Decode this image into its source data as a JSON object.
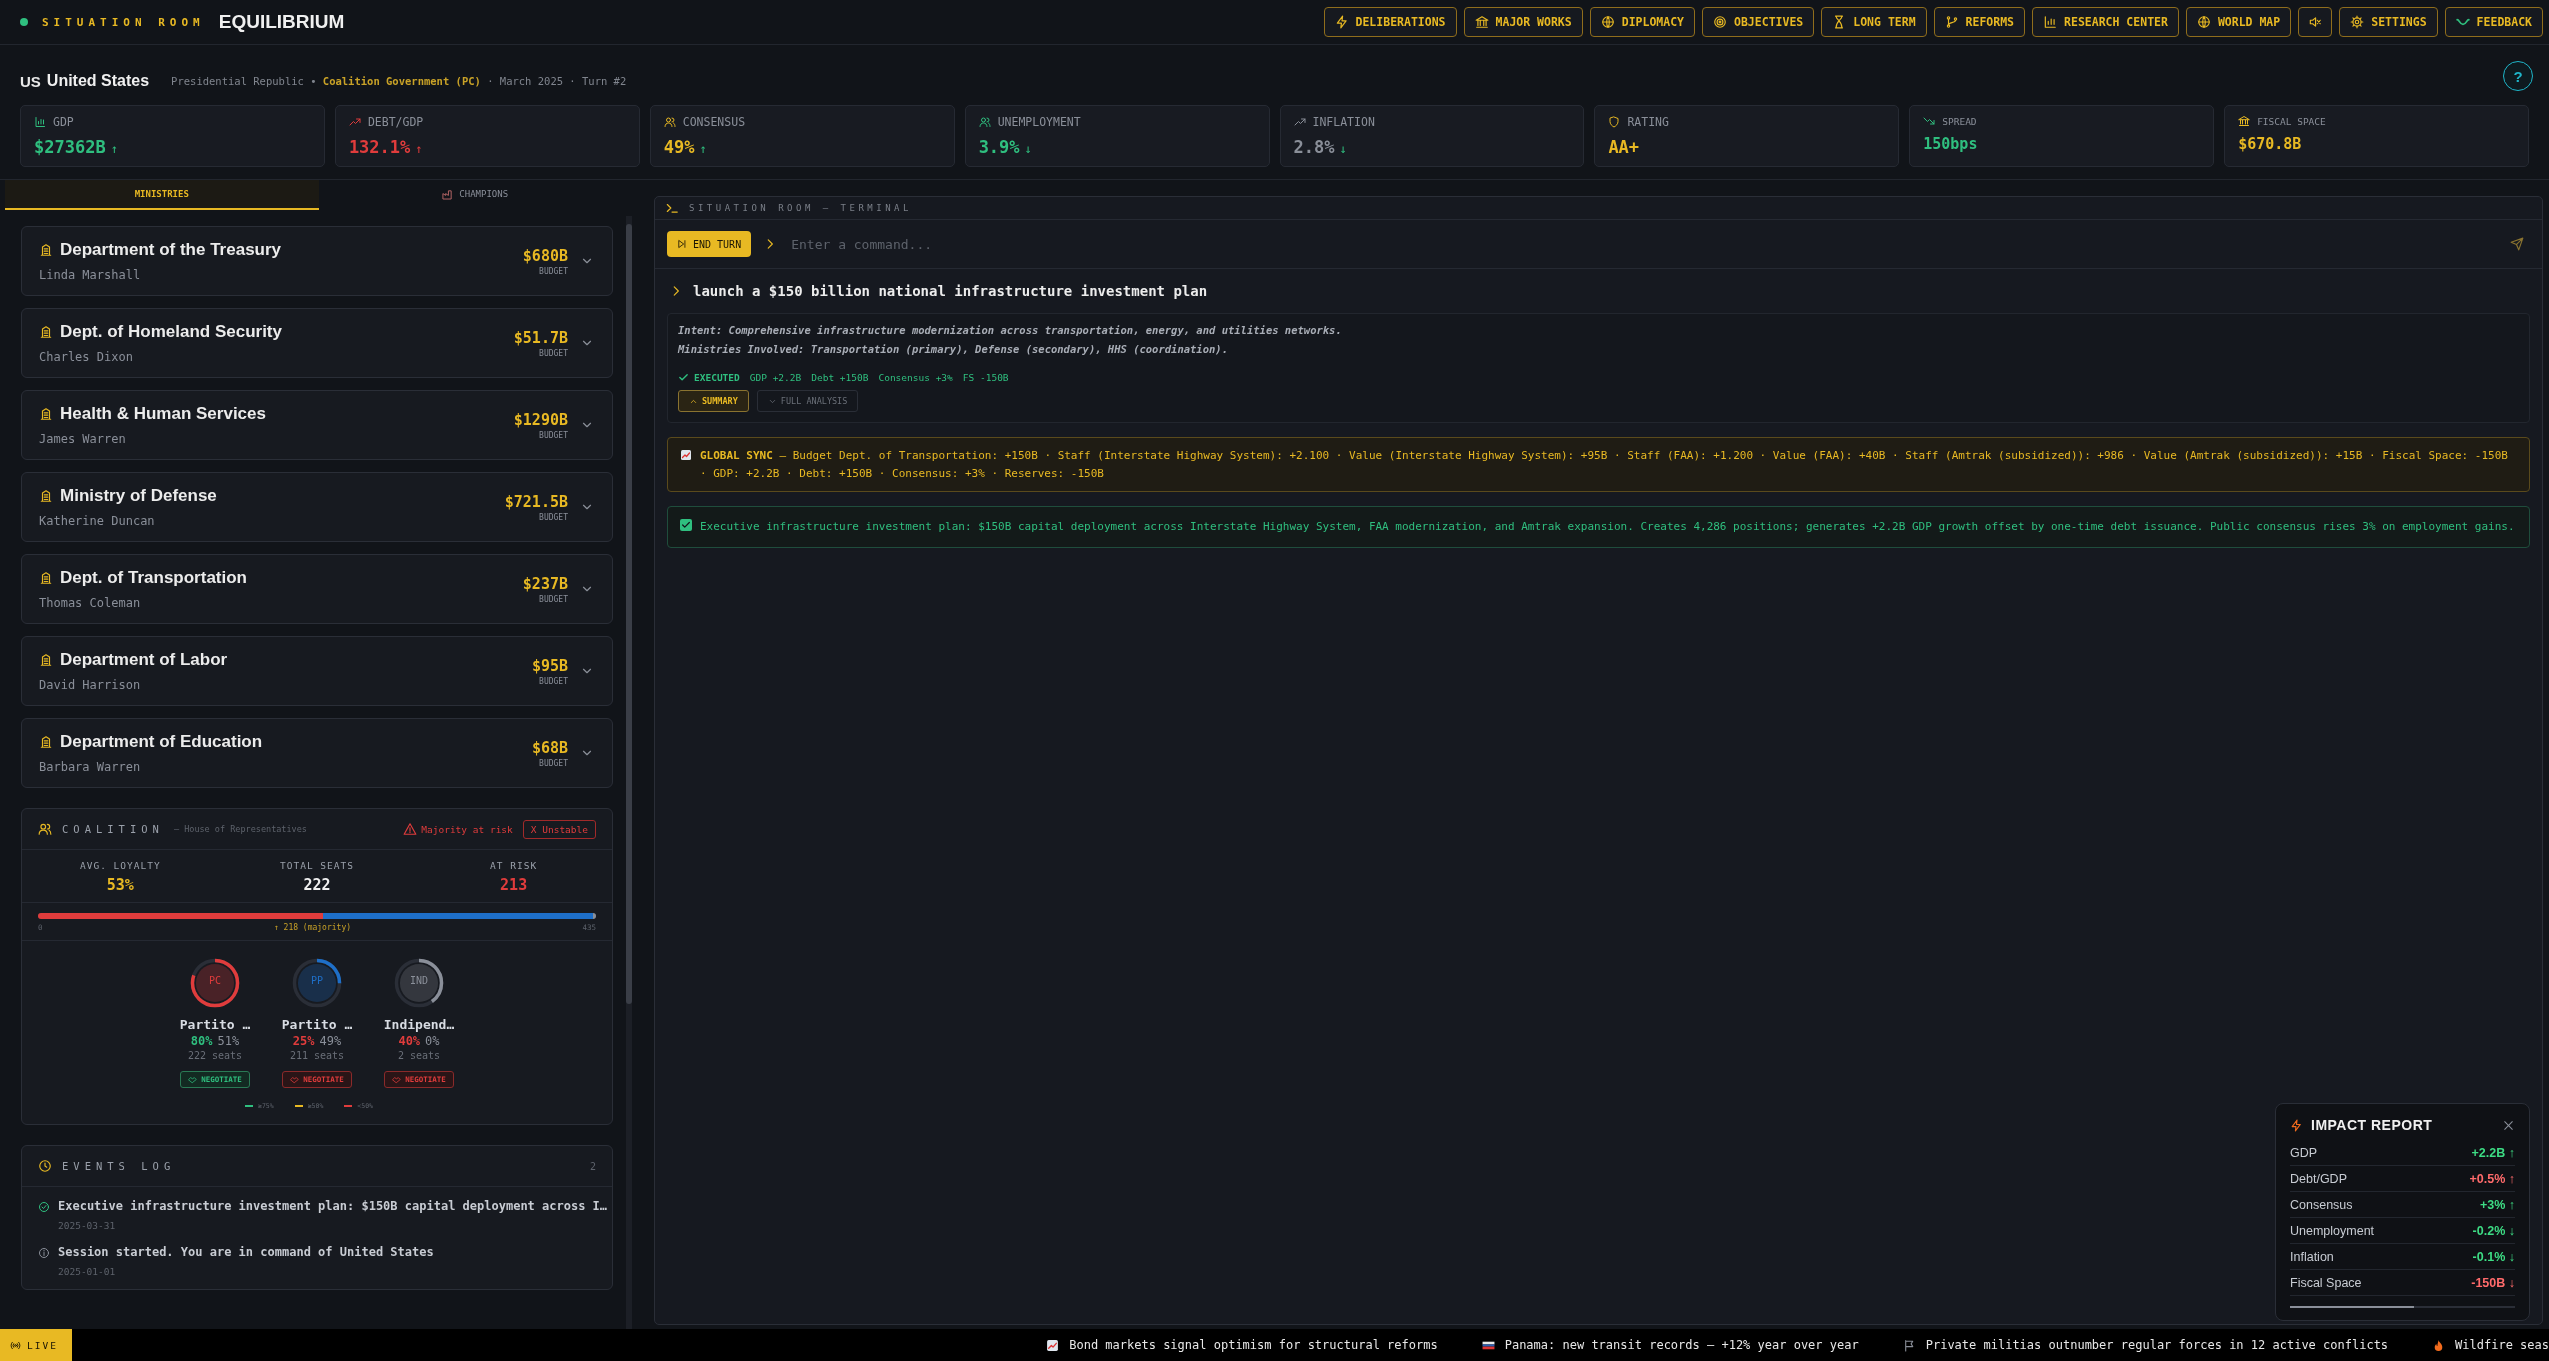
{
  "app": {
    "brand": "SITUATION ROOM",
    "title": "EQUILIBRIUM"
  },
  "nav": [
    {
      "label": "DELIBERATIONS",
      "kind": "bolt"
    },
    {
      "label": "MAJOR WORKS",
      "kind": "bank"
    },
    {
      "label": "DIPLOMACY",
      "kind": "globe"
    },
    {
      "label": "OBJECTIVES",
      "kind": "target"
    },
    {
      "label": "LONG TERM",
      "kind": "hourglass"
    },
    {
      "label": "REFORMS",
      "kind": "branch"
    },
    {
      "label": "RESEARCH CENTER",
      "kind": "bars"
    },
    {
      "label": "WORLD MAP",
      "kind": "globe"
    },
    {
      "kind": "mute"
    },
    {
      "label": "SETTINGS",
      "kind": "gear"
    },
    {
      "label": "FEEDBACK",
      "kind": "wave"
    }
  ],
  "country": {
    "code": "US",
    "name": "United States",
    "subtitle": "Presidential Republic • **Coalition Government (PC)** · March 2025 · Turn #2"
  },
  "help": "?",
  "kpis": [
    {
      "label": "GDP",
      "value": "$27362B",
      "color": "#2fbf7f",
      "kind": "standard",
      "arrow": "↑",
      "good": true
    },
    {
      "label": "DEBT/GDP",
      "value": "132.1%",
      "color": "#e03c3c",
      "kind": "standard",
      "arrow": "↑",
      "good": false
    },
    {
      "label": "CONSENSUS",
      "value": "49%",
      "color": "#e8b923",
      "kind": "standard",
      "arrow": "↑",
      "good": true
    },
    {
      "label": "UNEMPLOYMENT",
      "value": "3.9%",
      "color": "#2fbf7f",
      "kind": "standard",
      "arrow": "↓",
      "good": true
    },
    {
      "label": "INFLATION",
      "value": "2.8%",
      "color": "#8a8f99",
      "kind": "standard",
      "arrow": "↓",
      "good": true
    },
    {
      "label": "RATING",
      "value": "AA+",
      "color": "#e8b923",
      "kind": "standard"
    },
    {
      "label": "SPREAD",
      "value": "150bps",
      "color": "#2fbf7f",
      "kind": "compact"
    },
    {
      "label": "FISCAL SPACE",
      "value": "$670.8B",
      "color": "#e8b923",
      "kind": "compact"
    }
  ],
  "tabs": [
    {
      "label": "MINISTRIES",
      "selected": true
    },
    {
      "label": "CHAMPIONS",
      "selected": false
    }
  ],
  "ministries": [
    {
      "name": "Department of the Treasury",
      "minister": "Linda Marshall",
      "budget": "$680B",
      "budget_label": "BUDGET",
      "expanded": false
    },
    {
      "name": "Dept. of Homeland Security",
      "minister": "Charles Dixon",
      "budget": "$51.7B",
      "budget_label": "BUDGET",
      "expanded": false
    },
    {
      "name": "Health & Human Services",
      "minister": "James Warren",
      "budget": "$1290B",
      "budget_label": "BUDGET",
      "expanded": false
    },
    {
      "name": "Ministry of Defense",
      "minister": "Katherine Duncan",
      "budget": "$721.5B",
      "budget_label": "BUDGET",
      "expanded": false
    },
    {
      "name": "Dept. of Transportation",
      "minister": "Thomas Coleman",
      "budget": "$237B",
      "budget_label": "BUDGET",
      "expanded": false
    },
    {
      "name": "Department of Labor",
      "minister": "David Harrison",
      "budget": "$95B",
      "budget_label": "BUDGET",
      "expanded": false
    },
    {
      "name": "Department of Education",
      "minister": "Barbara Warren",
      "budget": "$68B",
      "budget_label": "BUDGET",
      "expanded": false
    }
  ],
  "coalition": {
    "title": "COALITION",
    "chamber": "— House of Representatives",
    "warning": "Majority at risk",
    "status": "X Unstable",
    "stats": [
      {
        "label": "AVG. LOYALTY",
        "value": "53%",
        "color": "#e8b923"
      },
      {
        "label": "TOTAL SEATS",
        "value": "222",
        "color": "#f0f0f0"
      },
      {
        "label": "AT RISK",
        "value": "213",
        "color": "#e03c3c"
      }
    ],
    "bar_start": "0",
    "majority": "↑ 218 (majority)",
    "bar_end": "435",
    "parties": [
      {
        "abbr": "PC",
        "name": "Partito …",
        "loyalty": "80%",
        "share": "51%",
        "seats": "222 seats",
        "color": "#e03c3c",
        "action": "NEGOTIATE"
      },
      {
        "abbr": "PP",
        "name": "Partito …",
        "loyalty": "25%",
        "share": "49%",
        "seats": "211 seats",
        "color": "#1e6fc8",
        "action": "NEGOTIATE"
      },
      {
        "abbr": "IND",
        "name": "Indipend…",
        "loyalty": "40%",
        "share": "0%",
        "seats": "2 seats",
        "color": "#8a8f99",
        "action": "NEGOTIATE"
      }
    ],
    "legend": [
      {
        "label": "≥75%",
        "color": "#2fbf7f"
      },
      {
        "label": "≥50%",
        "color": "#e8b923"
      },
      {
        "label": "<50%",
        "color": "#e03c3c"
      }
    ]
  },
  "events": {
    "title": "EVENTS LOG",
    "count": "2",
    "items": [
      {
        "kind": "success",
        "text": "Executive infrastructure investment plan: $150B capital deployment across I…",
        "date": "2025-03-31"
      },
      {
        "kind": "info",
        "text": "Session started. You are in command of United States",
        "date": "2025-01-01"
      }
    ]
  },
  "terminal": {
    "title": "SITUATION ROOM — TERMINAL",
    "end_turn": "END TURN",
    "placeholder": "Enter a command...",
    "command": "launch a $150 billion national infrastructure investment plan",
    "intent": "Intent: Comprehensive infrastructure modernization across transportation, energy, and utilities networks.",
    "involved": "Ministries Involved: Transportation (primary), Defense (secondary), HHS (coordination).",
    "status": "EXECUTED",
    "effects": [
      "GDP +2.2B",
      "Debt +150B",
      "Consensus +3%",
      "FS -150B"
    ],
    "views": [
      {
        "label": "SUMMARY",
        "selected": true
      },
      {
        "label": "FULL ANALYSIS",
        "selected": false
      }
    ],
    "sync": "**GLOBAL SYNC** — Budget Dept. of Transportation: +150B · Staff (Interstate Highway System): +2.100 · Value (Interstate Highway System): +95B · Staff (FAA): +1.200 · Value (FAA): +40B · Staff (Amtrak (subsidized)): +986 · Value (Amtrak (subsidized)): +15B · Fiscal Space: -150B · GDP: +2.2B · Debt: +150B · Consensus: +3% · Reserves: -150B",
    "outcome": "Executive infrastructure investment plan: $150B capital deployment across Interstate Highway System, FAA modernization, and Amtrak expansion. Creates 4,286 positions; generates +2.2B GDP growth offset by one-time debt issuance. Public consensus rises 3% on employment gains."
  },
  "impact": {
    "title": "IMPACT REPORT",
    "rows": [
      {
        "label": "GDP",
        "value": "+2.2B ↑",
        "good": true
      },
      {
        "label": "Debt/GDP",
        "value": "+0.5% ↑",
        "good": false
      },
      {
        "label": "Consensus",
        "value": "+3% ↑",
        "good": true
      },
      {
        "label": "Unemployment",
        "value": "-0.2% ↓",
        "good": true
      },
      {
        "label": "Inflation",
        "value": "-0.1% ↓",
        "good": true
      },
      {
        "label": "Fiscal Space",
        "value": "-150B ↓",
        "good": false
      }
    ],
    "level": 0.55
  },
  "ticker": {
    "live": "LIVE",
    "items": [
      {
        "kind": "chart",
        "text": "Bond markets signal optimism for structural reforms"
      },
      {
        "kind": "flag-stripes",
        "text": "Panama: new transit records — +12% year over year"
      },
      {
        "kind": "flag",
        "text": "Private militias outnumber regular forces in 12 active conflicts"
      },
      {
        "kind": "fire",
        "text": "Wildfire seas"
      }
    ]
  }
}
